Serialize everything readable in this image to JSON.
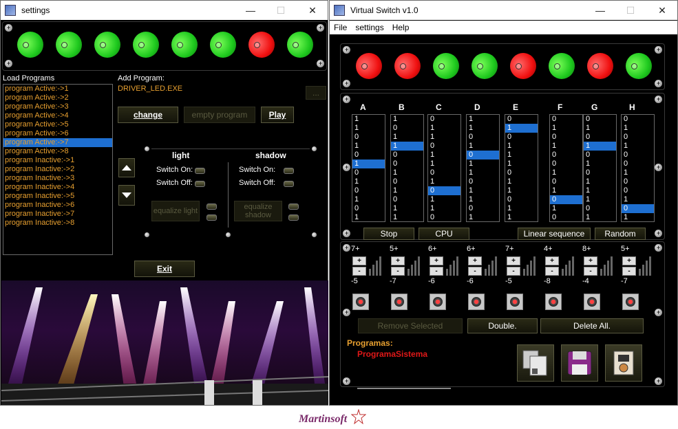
{
  "settings": {
    "title": "settings",
    "leds": [
      "green",
      "green",
      "green",
      "green",
      "green",
      "green",
      "red",
      "green"
    ],
    "load_programs_label": "Load Programs",
    "programs": [
      "program Active:->1",
      "program Active:->2",
      "program Active:->3",
      "program Active:->4",
      "program Active:->5",
      "program Active:->6",
      "program Active:->7",
      "program Active:->8",
      "program Inactive:->1",
      "program Inactive:->2",
      "program Inactive:->3",
      "program Inactive:->4",
      "program Inactive:->5",
      "program Inactive:->6",
      "program Inactive:->7",
      "program Inactive:->8"
    ],
    "selected_program_index": 6,
    "add_program_label": "Add Program:",
    "add_program_value": "DRIVER_LED.EXE",
    "browse_label": "...",
    "change_label": "change",
    "empty_program_label": "empty program",
    "play_label": "Play",
    "light_label": "light",
    "shadow_label": "shadow",
    "switch_on_label": "Switch On:",
    "switch_off_label": "Switch Off:",
    "equalize_light_label": "equalize light",
    "equalize_shadow_label": "equalize shadow",
    "exit_label": "Exit"
  },
  "vs": {
    "title": "Virtual Switch v1.0",
    "menu": [
      "File",
      "settings",
      "Help"
    ],
    "leds": [
      "red",
      "red",
      "green",
      "green",
      "red",
      "green",
      "red",
      "green"
    ],
    "columns": [
      {
        "name": "A",
        "bits": [
          "1",
          "1",
          "0",
          "1",
          "0",
          "1",
          "0",
          "1",
          "0",
          "1",
          "0",
          "1"
        ],
        "sel": 5
      },
      {
        "name": "B",
        "bits": [
          "1",
          "0",
          "1",
          "1",
          "0",
          "0",
          "1",
          "0",
          "1",
          "0",
          "1",
          "1"
        ],
        "sel": 3
      },
      {
        "name": "C",
        "bits": [
          "0",
          "1",
          "1",
          "0",
          "1",
          "1",
          "0",
          "1",
          "0",
          "1",
          "1",
          "0"
        ],
        "sel": 8
      },
      {
        "name": "D",
        "bits": [
          "1",
          "1",
          "0",
          "1",
          "0",
          "1",
          "1",
          "0",
          "1",
          "1",
          "0",
          "1"
        ],
        "sel": 4
      },
      {
        "name": "E",
        "bits": [
          "0",
          "1",
          "0",
          "1",
          "1",
          "1",
          "0",
          "1",
          "1",
          "0",
          "1",
          "1"
        ],
        "sel": 1
      },
      {
        "name": "F",
        "bits": [
          "0",
          "1",
          "0",
          "1",
          "0",
          "0",
          "1",
          "0",
          "1",
          "0",
          "1",
          "0"
        ],
        "sel": 9
      },
      {
        "name": "G",
        "bits": [
          "0",
          "1",
          "0",
          "1",
          "0",
          "1",
          "0",
          "1",
          "1",
          "1",
          "0",
          "1"
        ],
        "sel": 3
      },
      {
        "name": "H",
        "bits": [
          "0",
          "1",
          "0",
          "1",
          "0",
          "0",
          "1",
          "0",
          "0",
          "1",
          "0",
          "1"
        ],
        "sel": 10
      }
    ],
    "stop_label": "Stop",
    "cpu_label": "CPU",
    "linear_label": "Linear sequence",
    "random_label": "Random",
    "channels": [
      {
        "top": "7+",
        "bottom": "-5"
      },
      {
        "top": "5+",
        "bottom": "-7"
      },
      {
        "top": "6+",
        "bottom": "-6"
      },
      {
        "top": "6+",
        "bottom": "-6"
      },
      {
        "top": "7+",
        "bottom": "-5"
      },
      {
        "top": "4+",
        "bottom": "-8"
      },
      {
        "top": "8+",
        "bottom": "-4"
      },
      {
        "top": "5+",
        "bottom": "-7"
      }
    ],
    "plus": "+",
    "minus": "-",
    "remove_selected_label": "Remove Selected",
    "double_label": "Double.",
    "delete_all_label": "Delete All.",
    "programas_label": "Programas:",
    "programas_value": "ProgramaSistema"
  },
  "logo_text": "Martinsoft",
  "colors": {
    "accent_green": "#1ec91e",
    "accent_red": "#f01010",
    "selection": "#1e6fd1",
    "program_text": "#e8a030"
  }
}
